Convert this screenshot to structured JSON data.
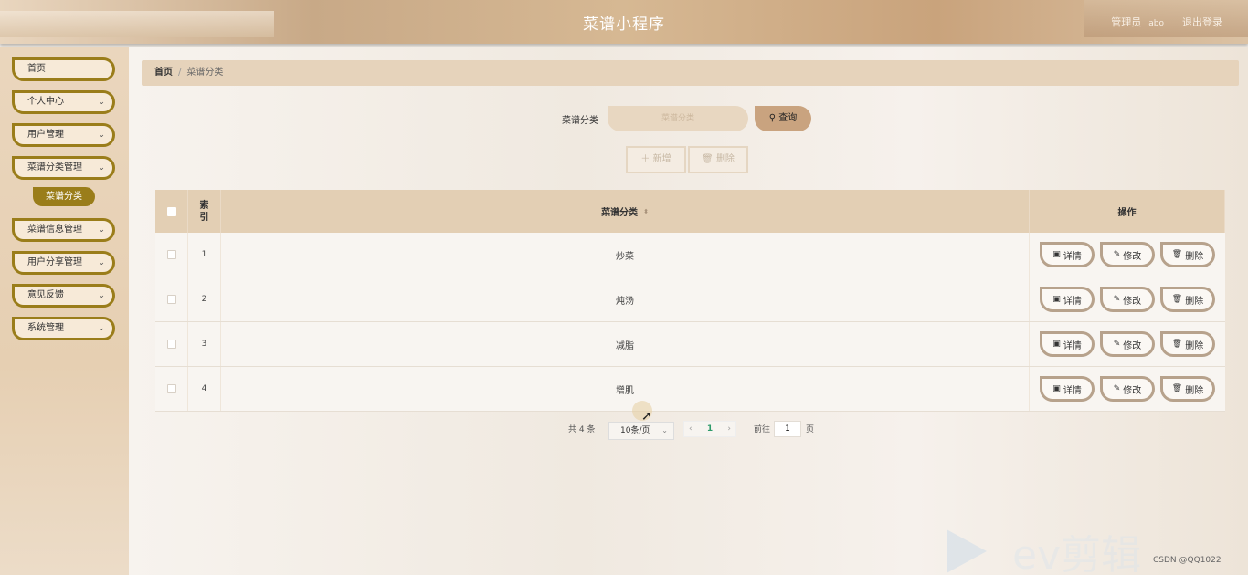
{
  "header": {
    "title": "菜谱小程序",
    "user_role": "管理员",
    "user_name": "abo",
    "logout": "退出登录"
  },
  "sidebar": {
    "items": [
      {
        "label": "首页"
      },
      {
        "label": "个人中心"
      },
      {
        "label": "用户管理"
      },
      {
        "label": "菜谱分类管理"
      },
      {
        "label": "菜谱信息管理"
      },
      {
        "label": "用户分享管理"
      },
      {
        "label": "意见反馈"
      },
      {
        "label": "系统管理"
      }
    ],
    "sub_item": "菜谱分类"
  },
  "breadcrumb": {
    "home": "首页",
    "separator": "/",
    "current": "菜谱分类"
  },
  "search": {
    "label": "菜谱分类",
    "placeholder": "菜谱分类",
    "query_button": "查询"
  },
  "actions": {
    "add": "新增",
    "delete": "删除"
  },
  "table": {
    "headers": {
      "index": "索引",
      "name": "菜谱分类",
      "ops": "操作"
    },
    "rows": [
      {
        "index": "1",
        "name": "炒菜"
      },
      {
        "index": "2",
        "name": "炖汤"
      },
      {
        "index": "3",
        "name": "减脂"
      },
      {
        "index": "4",
        "name": "增肌"
      }
    ],
    "ops": {
      "detail": "详情",
      "edit": "修改",
      "delete": "删除"
    }
  },
  "pagination": {
    "total": "共 4 条",
    "page_size": "10条/页",
    "current_page": "1",
    "goto_label": "前往",
    "goto_value": "1",
    "page_suffix": "页"
  },
  "watermark": {
    "text": "ev剪辑",
    "credit": "CSDN @QQ1022"
  },
  "icons": {
    "search": "search-icon",
    "plus": "plus-icon",
    "trash": "trash-icon",
    "detail": "document-icon",
    "edit": "pencil-icon",
    "chevron": "chevron-down-icon",
    "sort": "sort-icon"
  },
  "colors": {
    "accent": "#9a7d1a",
    "header_bg": "#c8a987",
    "table_head": "#e3cfb4",
    "query_btn": "#c9a37f",
    "pager_active": "#2e9b6b"
  }
}
